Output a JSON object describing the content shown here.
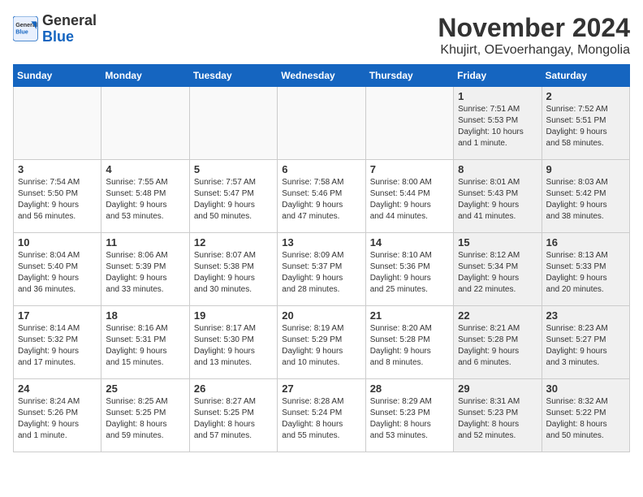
{
  "header": {
    "logo_general": "General",
    "logo_blue": "Blue",
    "month_title": "November 2024",
    "location": "Khujirt, OEvoerhangay, Mongolia"
  },
  "weekdays": [
    "Sunday",
    "Monday",
    "Tuesday",
    "Wednesday",
    "Thursday",
    "Friday",
    "Saturday"
  ],
  "weeks": [
    [
      {
        "day": "",
        "info": "",
        "empty": true
      },
      {
        "day": "",
        "info": "",
        "empty": true
      },
      {
        "day": "",
        "info": "",
        "empty": true
      },
      {
        "day": "",
        "info": "",
        "empty": true
      },
      {
        "day": "",
        "info": "",
        "empty": true
      },
      {
        "day": "1",
        "info": "Sunrise: 7:51 AM\nSunset: 5:53 PM\nDaylight: 10 hours\nand 1 minute.",
        "shaded": true
      },
      {
        "day": "2",
        "info": "Sunrise: 7:52 AM\nSunset: 5:51 PM\nDaylight: 9 hours\nand 58 minutes.",
        "shaded": true
      }
    ],
    [
      {
        "day": "3",
        "info": "Sunrise: 7:54 AM\nSunset: 5:50 PM\nDaylight: 9 hours\nand 56 minutes."
      },
      {
        "day": "4",
        "info": "Sunrise: 7:55 AM\nSunset: 5:48 PM\nDaylight: 9 hours\nand 53 minutes."
      },
      {
        "day": "5",
        "info": "Sunrise: 7:57 AM\nSunset: 5:47 PM\nDaylight: 9 hours\nand 50 minutes."
      },
      {
        "day": "6",
        "info": "Sunrise: 7:58 AM\nSunset: 5:46 PM\nDaylight: 9 hours\nand 47 minutes."
      },
      {
        "day": "7",
        "info": "Sunrise: 8:00 AM\nSunset: 5:44 PM\nDaylight: 9 hours\nand 44 minutes."
      },
      {
        "day": "8",
        "info": "Sunrise: 8:01 AM\nSunset: 5:43 PM\nDaylight: 9 hours\nand 41 minutes.",
        "shaded": true
      },
      {
        "day": "9",
        "info": "Sunrise: 8:03 AM\nSunset: 5:42 PM\nDaylight: 9 hours\nand 38 minutes.",
        "shaded": true
      }
    ],
    [
      {
        "day": "10",
        "info": "Sunrise: 8:04 AM\nSunset: 5:40 PM\nDaylight: 9 hours\nand 36 minutes."
      },
      {
        "day": "11",
        "info": "Sunrise: 8:06 AM\nSunset: 5:39 PM\nDaylight: 9 hours\nand 33 minutes."
      },
      {
        "day": "12",
        "info": "Sunrise: 8:07 AM\nSunset: 5:38 PM\nDaylight: 9 hours\nand 30 minutes."
      },
      {
        "day": "13",
        "info": "Sunrise: 8:09 AM\nSunset: 5:37 PM\nDaylight: 9 hours\nand 28 minutes."
      },
      {
        "day": "14",
        "info": "Sunrise: 8:10 AM\nSunset: 5:36 PM\nDaylight: 9 hours\nand 25 minutes."
      },
      {
        "day": "15",
        "info": "Sunrise: 8:12 AM\nSunset: 5:34 PM\nDaylight: 9 hours\nand 22 minutes.",
        "shaded": true
      },
      {
        "day": "16",
        "info": "Sunrise: 8:13 AM\nSunset: 5:33 PM\nDaylight: 9 hours\nand 20 minutes.",
        "shaded": true
      }
    ],
    [
      {
        "day": "17",
        "info": "Sunrise: 8:14 AM\nSunset: 5:32 PM\nDaylight: 9 hours\nand 17 minutes."
      },
      {
        "day": "18",
        "info": "Sunrise: 8:16 AM\nSunset: 5:31 PM\nDaylight: 9 hours\nand 15 minutes."
      },
      {
        "day": "19",
        "info": "Sunrise: 8:17 AM\nSunset: 5:30 PM\nDaylight: 9 hours\nand 13 minutes."
      },
      {
        "day": "20",
        "info": "Sunrise: 8:19 AM\nSunset: 5:29 PM\nDaylight: 9 hours\nand 10 minutes."
      },
      {
        "day": "21",
        "info": "Sunrise: 8:20 AM\nSunset: 5:28 PM\nDaylight: 9 hours\nand 8 minutes."
      },
      {
        "day": "22",
        "info": "Sunrise: 8:21 AM\nSunset: 5:28 PM\nDaylight: 9 hours\nand 6 minutes.",
        "shaded": true
      },
      {
        "day": "23",
        "info": "Sunrise: 8:23 AM\nSunset: 5:27 PM\nDaylight: 9 hours\nand 3 minutes.",
        "shaded": true
      }
    ],
    [
      {
        "day": "24",
        "info": "Sunrise: 8:24 AM\nSunset: 5:26 PM\nDaylight: 9 hours\nand 1 minute."
      },
      {
        "day": "25",
        "info": "Sunrise: 8:25 AM\nSunset: 5:25 PM\nDaylight: 8 hours\nand 59 minutes."
      },
      {
        "day": "26",
        "info": "Sunrise: 8:27 AM\nSunset: 5:25 PM\nDaylight: 8 hours\nand 57 minutes."
      },
      {
        "day": "27",
        "info": "Sunrise: 8:28 AM\nSunset: 5:24 PM\nDaylight: 8 hours\nand 55 minutes."
      },
      {
        "day": "28",
        "info": "Sunrise: 8:29 AM\nSunset: 5:23 PM\nDaylight: 8 hours\nand 53 minutes."
      },
      {
        "day": "29",
        "info": "Sunrise: 8:31 AM\nSunset: 5:23 PM\nDaylight: 8 hours\nand 52 minutes.",
        "shaded": true
      },
      {
        "day": "30",
        "info": "Sunrise: 8:32 AM\nSunset: 5:22 PM\nDaylight: 8 hours\nand 50 minutes.",
        "shaded": true
      }
    ]
  ]
}
